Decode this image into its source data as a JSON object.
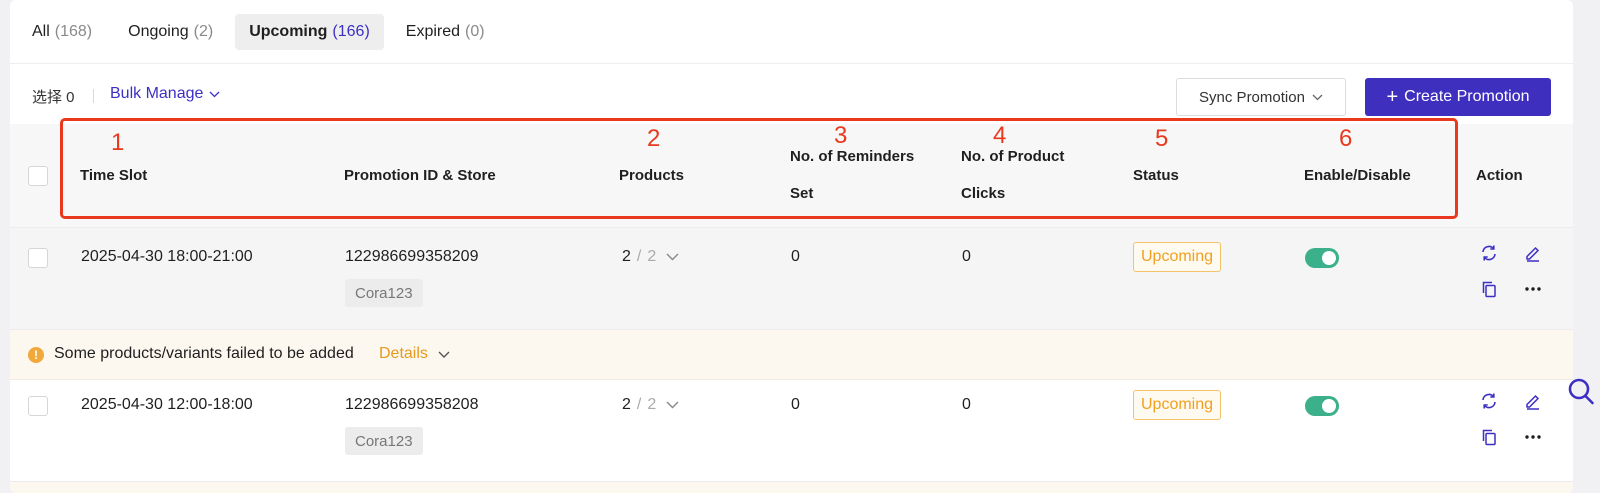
{
  "tabs": [
    {
      "label": "All",
      "count": "(168)"
    },
    {
      "label": "Ongoing",
      "count": "(2)"
    },
    {
      "label": "Upcoming",
      "count": "(166)"
    },
    {
      "label": "Expired",
      "count": "(0)"
    }
  ],
  "active_tab": "Upcoming",
  "toolbar": {
    "select_label": "选择 0",
    "bulk_manage": "Bulk Manage",
    "sync_promotion": "Sync Promotion",
    "create_promotion": "Create Promotion"
  },
  "table": {
    "headers": {
      "time_slot": "Time Slot",
      "promotion_id_store": "Promotion ID & Store",
      "products": "Products",
      "reminders_line1": "No. of Reminders",
      "reminders_line2": "Set",
      "clicks_line1": "No. of Product",
      "clicks_line2": "Clicks",
      "status": "Status",
      "enable_disable": "Enable/Disable",
      "action": "Action"
    },
    "rows": [
      {
        "time_slot": "2025-04-30 18:00-21:00",
        "promotion_id": "122986699358209",
        "store": "Cora123",
        "products_selected": "2",
        "products_total": "2",
        "reminders": "0",
        "clicks": "0",
        "status": "Upcoming",
        "enabled": true
      },
      {
        "time_slot": "2025-04-30 12:00-18:00",
        "promotion_id": "122986699358208",
        "store": "Cora123",
        "products_selected": "2",
        "products_total": "2",
        "reminders": "0",
        "clicks": "0",
        "status": "Upcoming",
        "enabled": true
      }
    ]
  },
  "warning": {
    "message": "Some products/variants failed to be added",
    "link": "Details"
  },
  "annotations": [
    "1",
    "2",
    "3",
    "4",
    "5",
    "6"
  ],
  "colors": {
    "accent": "#3e2fbf",
    "annotation": "#e8391e",
    "status_upcoming": "#f0a020",
    "toggle_on": "#3bb08a",
    "warning_bg": "#fdf8ef"
  },
  "icons": [
    "chevron-down-icon",
    "plus-icon",
    "refresh-icon",
    "edit-icon",
    "copy-icon",
    "more-icon",
    "warning-icon",
    "search-icon"
  ]
}
